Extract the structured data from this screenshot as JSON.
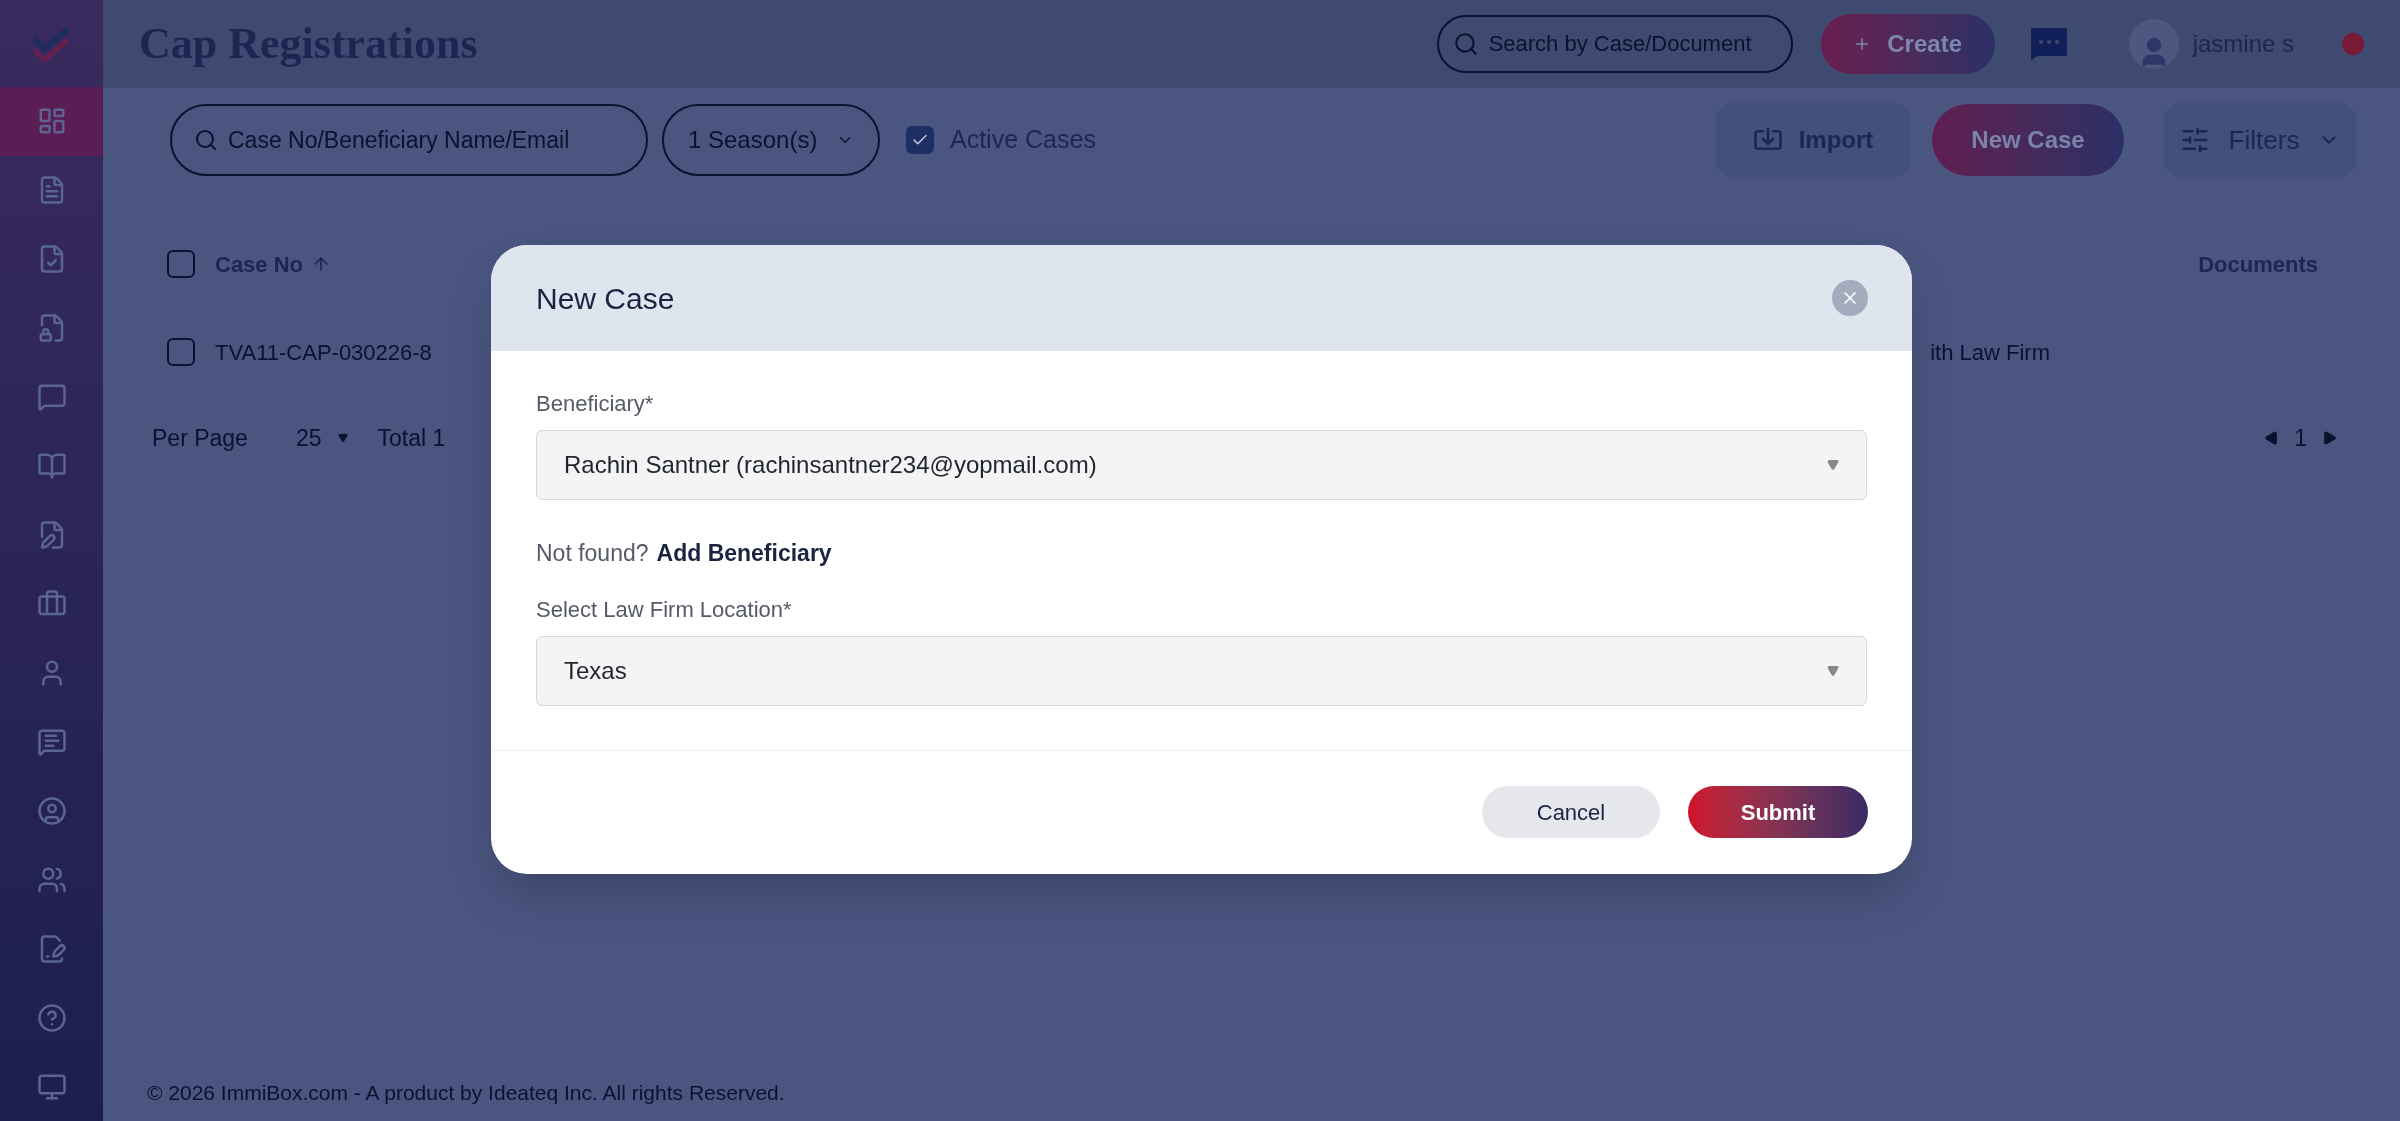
{
  "header": {
    "title": "Cap Registrations",
    "search": {
      "placeholder": "Search by Case/Document"
    },
    "create_button": "Create",
    "user": {
      "name": "jasmine s"
    }
  },
  "sidebar": {
    "items": [
      {
        "selected": true
      },
      {
        "selected": false
      },
      {
        "selected": false
      },
      {
        "selected": false
      },
      {
        "selected": false
      },
      {
        "selected": false
      },
      {
        "selected": false
      },
      {
        "selected": false
      },
      {
        "selected": false
      },
      {
        "selected": false
      },
      {
        "selected": false
      },
      {
        "selected": false
      },
      {
        "selected": false
      },
      {
        "selected": false
      },
      {
        "selected": false
      }
    ]
  },
  "toolbar": {
    "search": {
      "placeholder": "Case No/Beneficiary Name/Email"
    },
    "season_select": "1 Season(s)",
    "active_cases": {
      "label": "Active Cases",
      "checked": true
    },
    "import_button": "Import",
    "new_case_button": "New Case",
    "filters_button": "Filters"
  },
  "table": {
    "all_checked": false,
    "columns": [
      {
        "label": "Case No",
        "sorted": true
      },
      {
        "label": "Documents",
        "sorted": false
      }
    ],
    "rows": [
      {
        "case_no": "TVA11-CAP-030226-8",
        "column_2": "ith Law Firm",
        "checked": false
      }
    ]
  },
  "pagination": {
    "per_page_label": "Per Page",
    "per_page": "25",
    "total": "Total 1",
    "page": "1"
  },
  "modal": {
    "title": "New Case",
    "fields": [
      {
        "label": "Beneficiary*",
        "value": "Rachin Santner (rachinsantner234@yopmail.com)"
      },
      {
        "label": "Select Law Firm Location*",
        "value": "Texas"
      }
    ],
    "hint": "Not found?",
    "hint_link": "Add Beneficiary",
    "cancel_button": "Cancel",
    "submit_button": "Submit"
  },
  "footer": "© 2026 ImmiBox.com - A product by Ideateq Inc. All rights Reserved."
}
